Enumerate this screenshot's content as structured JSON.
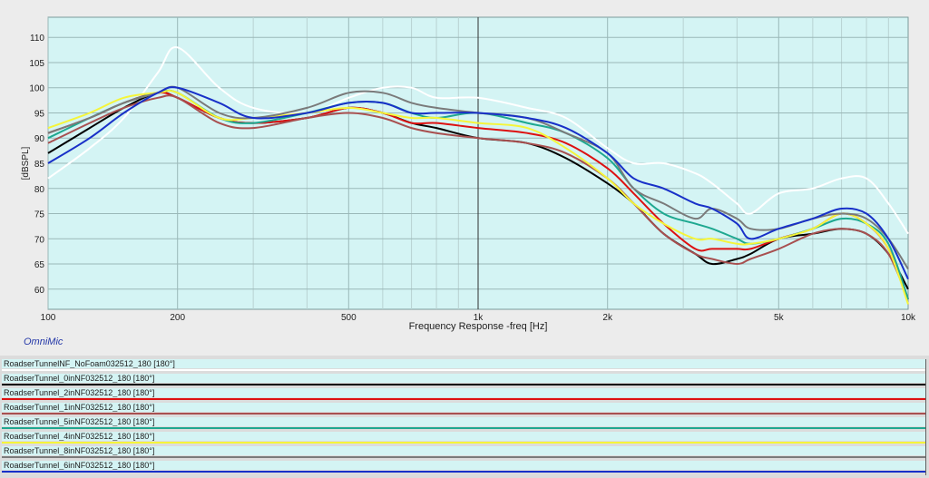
{
  "chart_data": {
    "type": "line",
    "title": "",
    "xlabel": "Frequency Response -freq [Hz]",
    "ylabel": "[dBSPL]",
    "xscale": "log",
    "xlim": [
      100,
      10000
    ],
    "ylim": [
      56,
      114
    ],
    "x_ticks": [
      100,
      200,
      500,
      1000,
      2000,
      5000,
      10000
    ],
    "x_tick_labels": [
      "100",
      "200",
      "500",
      "1k",
      "2k",
      "5k",
      "10k"
    ],
    "y_ticks": [
      60,
      65,
      70,
      75,
      80,
      85,
      90,
      95,
      100,
      105,
      110
    ],
    "y_tick_labels": [
      "60",
      "65",
      "70",
      "75",
      "80",
      "85",
      "90",
      "95",
      "100",
      "105",
      "110"
    ],
    "grid": true,
    "plot_background": "#d4f4f4",
    "cursor_frequency": 1000,
    "x": [
      100,
      125,
      150,
      180,
      200,
      250,
      300,
      400,
      500,
      600,
      700,
      800,
      1000,
      1300,
      1600,
      2000,
      2300,
      2700,
      3200,
      3500,
      4000,
      4300,
      5000,
      6000,
      7000,
      8000,
      9000,
      10000
    ],
    "series": [
      {
        "name": "RoadserTunnelNF_NoFoam032512_180 [180°]",
        "color": "#ffffff",
        "values": [
          82,
          88,
          94,
          103,
          108,
          100,
          96,
          95,
          98,
          100,
          100,
          98,
          98,
          96,
          94,
          88,
          85,
          85,
          83,
          81,
          77,
          75,
          79,
          80,
          82,
          82,
          77,
          71
        ]
      },
      {
        "name": "RoadserTunnel_0inNF032512_180 [180°]",
        "color": "#000000",
        "values": [
          87,
          92,
          96,
          99,
          98,
          94,
          93,
          94,
          96,
          95,
          93,
          92,
          90,
          89,
          86,
          81,
          77,
          71,
          67,
          65,
          66,
          67,
          70,
          71,
          72,
          71,
          67,
          60
        ]
      },
      {
        "name": "RoadserTunnel_2inNF032512_180 [180°]",
        "color": "#dd1111",
        "values": [
          91,
          94,
          97,
          99,
          98,
          94,
          93,
          94,
          96,
          95,
          93,
          93,
          92,
          91,
          89,
          84,
          79,
          73,
          68,
          68,
          68,
          68,
          70,
          72,
          75,
          73,
          68,
          58
        ]
      },
      {
        "name": "RoadserTunnel_1inNF032512_180 [180°]",
        "color": "#a85050",
        "values": [
          89,
          93,
          96,
          98,
          98,
          93,
          92,
          94,
          95,
          94,
          92,
          91,
          90,
          89,
          87,
          82,
          77,
          71,
          67,
          66,
          65,
          66,
          68,
          71,
          72,
          71,
          67,
          58
        ]
      },
      {
        "name": "RoadserTunnel_5inNF032512_180 [180°]",
        "color": "#1ea890",
        "values": [
          90,
          94,
          97,
          99,
          99,
          94,
          93,
          95,
          97,
          97,
          95,
          94,
          95,
          93,
          91,
          86,
          80,
          75,
          73,
          72,
          70,
          69,
          70,
          72,
          74,
          73,
          69,
          58
        ]
      },
      {
        "name": "RoadserTunnel_4inNF032512_180 [180°]",
        "color": "#f5f53a",
        "values": [
          92,
          95,
          98,
          99,
          99,
          94,
          94,
          95,
          96,
          95,
          94,
          94,
          93,
          92,
          88,
          82,
          77,
          73,
          70,
          70,
          69,
          69,
          70,
          72,
          75,
          73,
          68,
          57
        ]
      },
      {
        "name": "RoadserTunnel_8inNF032512_180 [180°]",
        "color": "#7a7a7a",
        "values": [
          91,
          94,
          97,
          99,
          100,
          95,
          94,
          96,
          99,
          99,
          97,
          96,
          95,
          94,
          91,
          87,
          80,
          77,
          74,
          76,
          74,
          72,
          72,
          74,
          75,
          74,
          70,
          64
        ]
      },
      {
        "name": "RoadserTunnel_6inNF032512_180 [180°]",
        "color": "#1830c8",
        "values": [
          85,
          90,
          95,
          99,
          100,
          97,
          94,
          95,
          97,
          97,
          95,
          95,
          95,
          94,
          92,
          87,
          82,
          80,
          77,
          76,
          73,
          70,
          72,
          74,
          76,
          75,
          70,
          62
        ]
      }
    ]
  },
  "branding": "OmniMic",
  "legend": [
    {
      "label": "RoadserTunnelNF_NoFoam032512_180 [180°]",
      "color": "#ffffff"
    },
    {
      "label": "RoadserTunnel_0inNF032512_180 [180°]",
      "color": "#000000"
    },
    {
      "label": "RoadserTunnel_2inNF032512_180 [180°]",
      "color": "#dd1111"
    },
    {
      "label": "RoadserTunnel_1inNF032512_180 [180°]",
      "color": "#a85050"
    },
    {
      "label": "RoadserTunnel_5inNF032512_180 [180°]",
      "color": "#1ea890"
    },
    {
      "label": "RoadserTunnel_4inNF032512_180 [180°]",
      "color": "#f5f53a"
    },
    {
      "label": "RoadserTunnel_8inNF032512_180 [180°]",
      "color": "#7a7a7a"
    },
    {
      "label": "RoadserTunnel_6inNF032512_180 [180°]",
      "color": "#1830c8"
    }
  ]
}
